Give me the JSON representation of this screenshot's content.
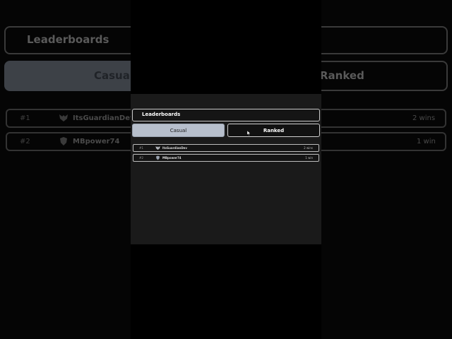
{
  "header": {
    "title": "Leaderboards"
  },
  "tabs": [
    {
      "label": "Casual",
      "selected": true
    },
    {
      "label": "Ranked",
      "selected": false
    }
  ],
  "leaderboard": [
    {
      "rank": "#1",
      "name": "ItsGuardianDev",
      "wins": "2 wins",
      "avatar": "guardian-mask-icon"
    },
    {
      "rank": "#2",
      "name": "MBpower74",
      "wins": "1 win",
      "avatar": "shield-avatar-icon"
    }
  ],
  "colors": {
    "selected_tab": "#b7bfcc",
    "panel": "#1a1a1a",
    "border": "#c8c8c8"
  }
}
